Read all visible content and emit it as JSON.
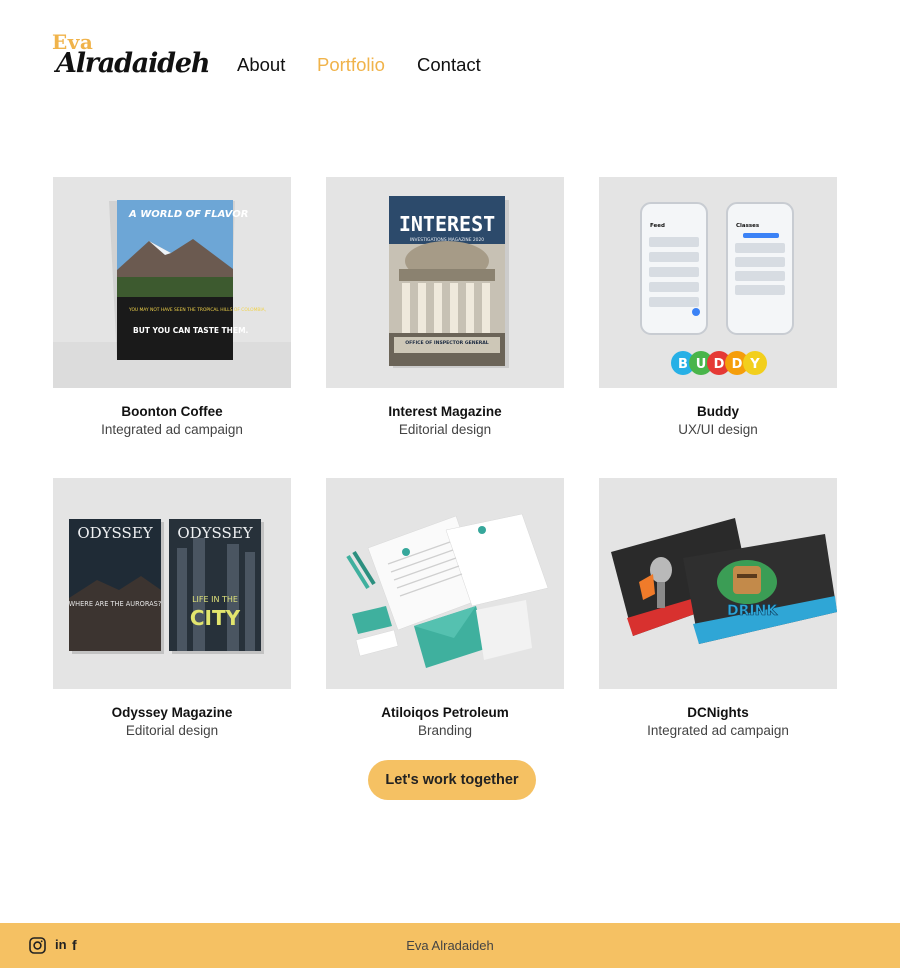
{
  "brand": {
    "first": "Eva",
    "last": "Alradaideh",
    "accent_color": "#f0b34a"
  },
  "nav": {
    "items": [
      {
        "label": "About"
      },
      {
        "label": "Portfolio",
        "active": true
      },
      {
        "label": "Contact"
      }
    ]
  },
  "portfolio": {
    "items": [
      {
        "title": "Boonton Coffee",
        "subtitle": "Integrated ad campaign",
        "thumb": {
          "headline": "A WORLD OF FLAVOR",
          "tag1": "YOU MAY NOT HAVE SEEN THE TROPICAL HILLS OF COLOMBIA,",
          "tag2": "BUT YOU CAN TASTE THEM."
        }
      },
      {
        "title": "Interest Magazine",
        "subtitle": "Editorial design",
        "thumb": {
          "headline": "INTEREST",
          "sub": "INVESTIGATIONS MAGAZINE 2020",
          "footer": "OFFICE OF INSPECTOR GENERAL"
        }
      },
      {
        "title": "Buddy",
        "subtitle": "UX/UI design",
        "thumb": {
          "letters": [
            "B",
            "U",
            "D",
            "D",
            "Y"
          ],
          "screen1": "Feed",
          "screen2": "Classes"
        }
      },
      {
        "title": "Odyssey Magazine",
        "subtitle": "Editorial design",
        "thumb": {
          "mast": "ODYSSEY",
          "cover1": "WHERE ARE THE AURORAS?",
          "cover2a": "LIFE IN THE",
          "cover2b": "CITY"
        }
      },
      {
        "title": "Atiloiqos Petroleum",
        "subtitle": "Branding",
        "thumb": {}
      },
      {
        "title": "DCNights",
        "subtitle": "Integrated ad campaign",
        "thumb": {
          "card_text": "DRINK"
        }
      }
    ]
  },
  "cta": {
    "label": "Let's work together"
  },
  "footer": {
    "name": "Eva Alradaideh",
    "social": [
      {
        "icon": "instagram-icon"
      },
      {
        "icon": "linkedin-icon",
        "glyph": "in"
      },
      {
        "icon": "facebook-icon",
        "glyph": "f"
      }
    ],
    "background": "#f5c163"
  }
}
